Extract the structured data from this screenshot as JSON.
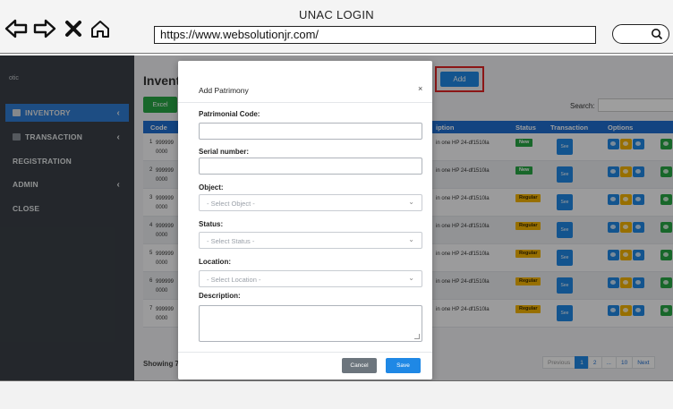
{
  "browser": {
    "title": "UNAC LOGIN",
    "url": "https://www.websolutionjr.com/"
  },
  "sidebar": {
    "brand": "otic",
    "items": [
      {
        "label": "INVENTORY",
        "active": true
      },
      {
        "label": "TRANSACTION",
        "active": false
      },
      {
        "label": "REGISTRATION",
        "active": false
      },
      {
        "label": "ADMIN",
        "active": false
      },
      {
        "label": "CLOSE",
        "active": false
      }
    ]
  },
  "main": {
    "title": "Invent",
    "excel_label": "Excel",
    "add_label": "Add",
    "search_label": "Search:",
    "columns": {
      "code": "Code",
      "description": "iption",
      "status": "Status",
      "transaction": "Transaction",
      "options": "Options"
    },
    "rows": [
      {
        "num": "1",
        "code": "999999",
        "code2": "0000",
        "description": "in one HP 24-df1510la",
        "status": "New",
        "action": "See"
      },
      {
        "num": "2",
        "code": "999999",
        "code2": "0000",
        "description": "in one HP 24-df1510la",
        "status": "New",
        "action": "See"
      },
      {
        "num": "3",
        "code": "999999",
        "code2": "0000",
        "description": "in one HP 24-df1510la",
        "status": "Regular",
        "action": "See"
      },
      {
        "num": "4",
        "code": "999999",
        "code2": "0000",
        "description": "in one HP 24-df1510la",
        "status": "Regular",
        "action": "See"
      },
      {
        "num": "5",
        "code": "999999",
        "code2": "0000",
        "description": "in one HP 24-df1510la",
        "status": "Regular",
        "action": "See"
      },
      {
        "num": "6",
        "code": "999999",
        "code2": "0000",
        "description": "in one HP 24-df1510la",
        "status": "Regular",
        "action": "See"
      },
      {
        "num": "7",
        "code": "999999",
        "code2": "0000",
        "description": "in one HP 24-df1510la",
        "status": "Regular",
        "action": "See"
      }
    ],
    "showing": "Showing 7",
    "pagination": {
      "previous": "Previous",
      "pages": [
        "1",
        "2",
        "...",
        "10"
      ],
      "next": "Next"
    }
  },
  "modal": {
    "title": "Add Patrimony",
    "close": "×",
    "fields": {
      "patrimonial_code": "Patrimonial Code:",
      "serial_number": "Serial number:",
      "object": "Object:",
      "object_placeholder": "- Select Object -",
      "status": "Status:",
      "status_placeholder": "- Select Status -",
      "location": "Location:",
      "location_placeholder": "- Select Location -",
      "description": "Description:"
    },
    "cancel": "Cancel",
    "save": "Save"
  },
  "colors": {
    "primary": "#1f88e5",
    "success": "#28a745",
    "warning": "#f4b400",
    "sidebar": "#3a4047",
    "highlight": "#e02424"
  }
}
